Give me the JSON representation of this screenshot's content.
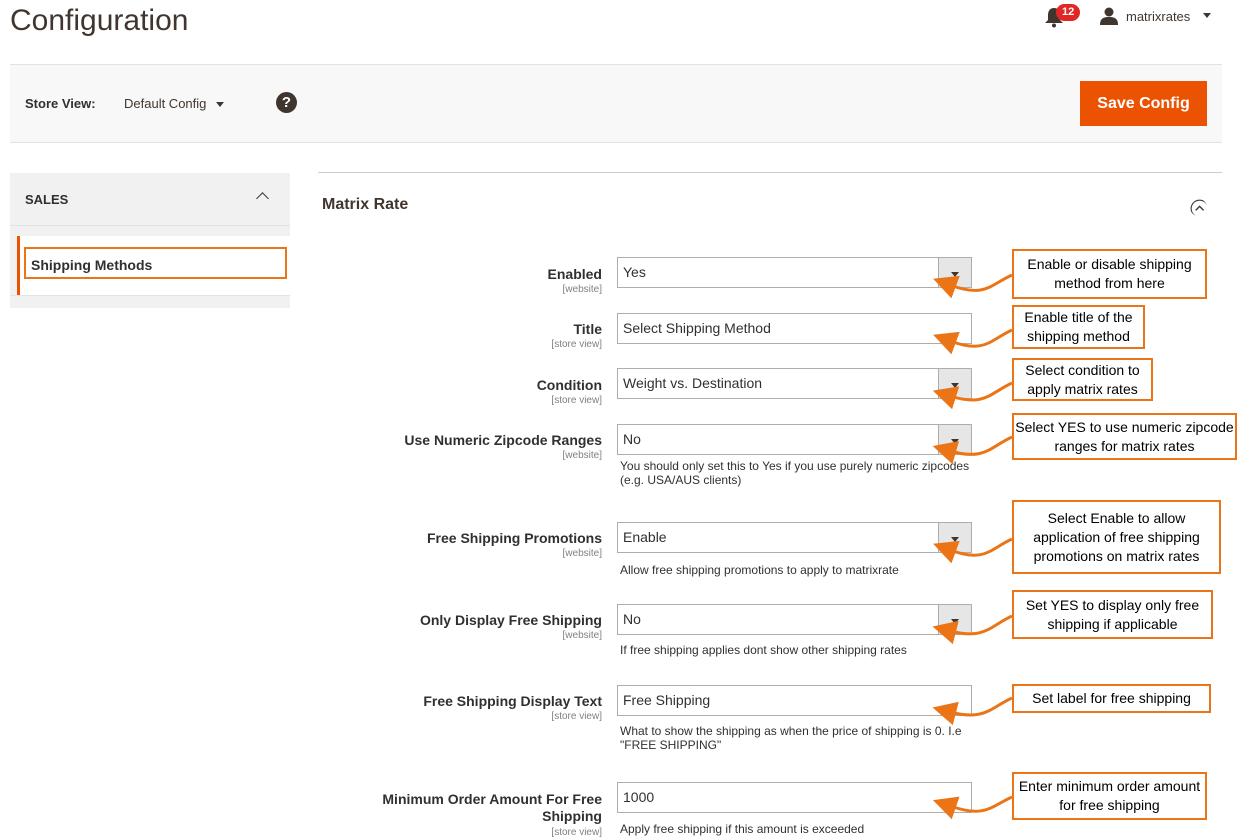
{
  "header": {
    "title": "Configuration",
    "notifications_count": "12",
    "username": "matrixrates"
  },
  "scope": {
    "label": "Store View:",
    "value": "Default Config",
    "help": "?",
    "save_label": "Save Config"
  },
  "sidebar": {
    "section": "SALES",
    "items": [
      {
        "label": "Shipping Methods",
        "active": true
      }
    ]
  },
  "section": {
    "title": "Matrix Rate"
  },
  "fields": [
    {
      "label": "Enabled",
      "scope": "[website]",
      "value": "Yes",
      "type": "select",
      "note": "",
      "callout": "Enable or disable shipping method from here"
    },
    {
      "label": "Title",
      "scope": "[store view]",
      "value": "Select Shipping Method",
      "type": "text",
      "note": "",
      "callout": "Enable title of the shipping method"
    },
    {
      "label": "Condition",
      "scope": "[store view]",
      "value": "Weight vs. Destination",
      "type": "select",
      "note": "",
      "callout": "Select condition to apply matrix rates"
    },
    {
      "label": "Use Numeric Zipcode Ranges",
      "scope": "[website]",
      "value": "No",
      "type": "select",
      "note": "You should only set this to Yes if you use purely numeric zipcodes (e.g. USA/AUS clients)",
      "callout": "Select YES to use numeric zipcode ranges for matrix rates"
    },
    {
      "label": "Free Shipping Promotions",
      "scope": "[website]",
      "value": "Enable",
      "type": "select",
      "note": "Allow free shipping promotions to apply to matrixrate",
      "callout": "Select Enable to allow application of free shipping promotions on matrix rates"
    },
    {
      "label": "Only Display Free Shipping",
      "scope": "[website]",
      "value": "No",
      "type": "select",
      "note": "If free shipping applies dont show other shipping rates",
      "callout": "Set YES to display only free shipping if applicable"
    },
    {
      "label": "Free Shipping Display Text",
      "scope": "[store view]",
      "value": "Free Shipping",
      "type": "text",
      "note": "What to show the shipping as when the price of shipping is 0. I.e \"FREE SHIPPING\"",
      "callout": "Set label for free shipping"
    },
    {
      "label": "Minimum Order Amount For Free Shipping",
      "scope": "[store view]",
      "value": "1000",
      "type": "text",
      "note": "Apply free shipping if this amount is exceeded",
      "callout": "Enter minimum order amount for free shipping"
    }
  ],
  "colors": {
    "accent": "#eb5202",
    "callout_border": "#eb7516",
    "notification_badge": "#e22626"
  }
}
